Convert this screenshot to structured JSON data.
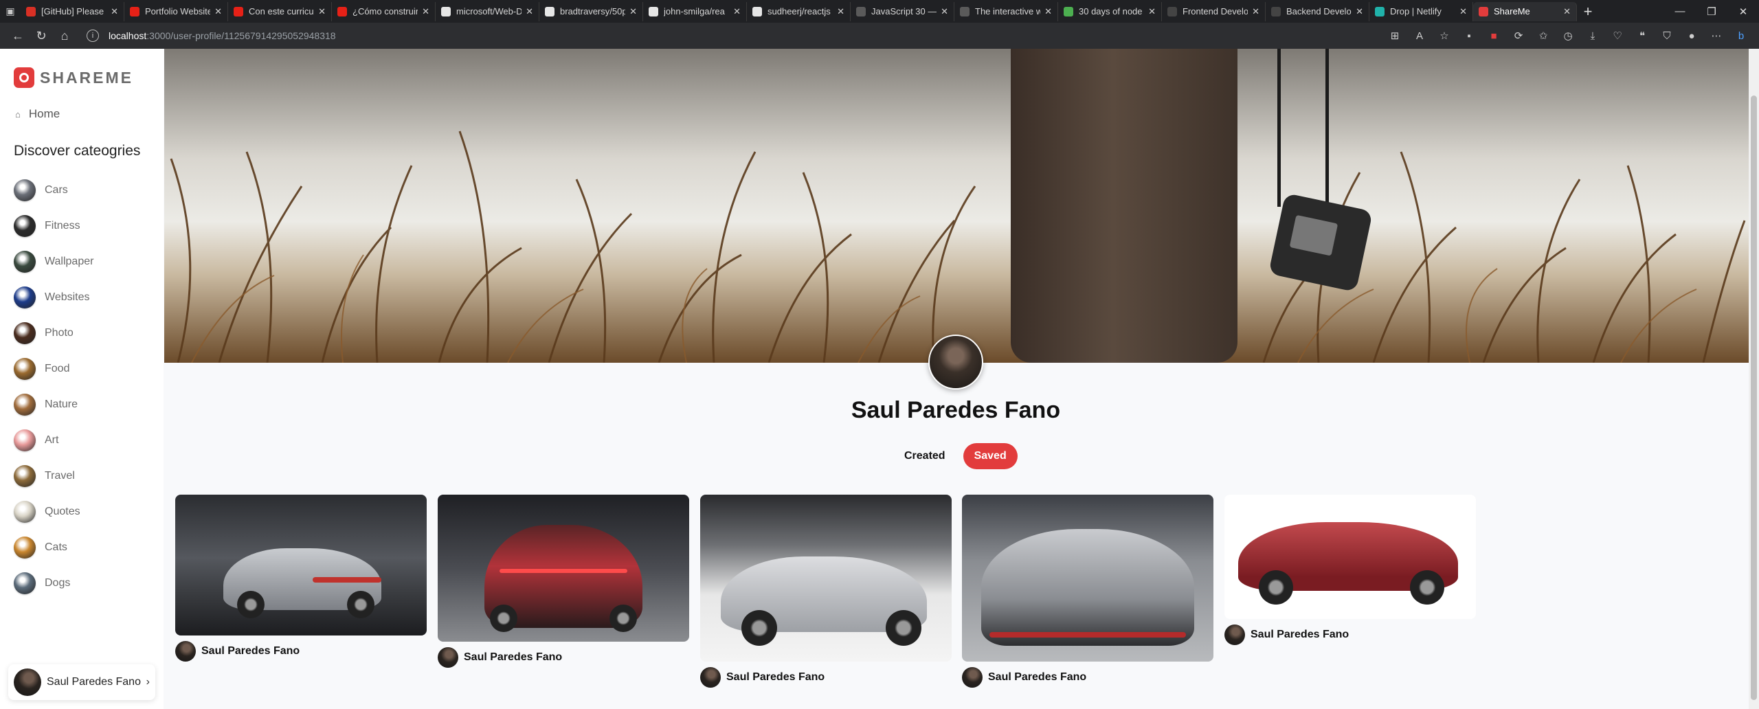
{
  "browser": {
    "tabs": [
      {
        "title": "[GitHub] Please",
        "icon": "gmail-icon",
        "color": "#d93025"
      },
      {
        "title": "Portfolio Website",
        "icon": "youtube-icon",
        "color": "#e62117"
      },
      {
        "title": "Con este curriculu",
        "icon": "youtube-icon",
        "color": "#e62117"
      },
      {
        "title": "¿Cómo construir",
        "icon": "youtube-icon",
        "color": "#e62117"
      },
      {
        "title": "microsoft/Web-D",
        "icon": "github-icon",
        "color": "#e6e6e6"
      },
      {
        "title": "bradtraversy/50p",
        "icon": "github-icon",
        "color": "#e6e6e6"
      },
      {
        "title": "john-smilga/rea",
        "icon": "github-icon",
        "color": "#e6e6e6"
      },
      {
        "title": "sudheerj/reactjs",
        "icon": "github-icon",
        "color": "#e6e6e6"
      },
      {
        "title": "JavaScript 30 —",
        "icon": "js30-icon",
        "color": "#5a5a5a"
      },
      {
        "title": "The interactive w",
        "icon": "ui-icon",
        "color": "#5a5a5a"
      },
      {
        "title": "30 days of node",
        "icon": "node-icon",
        "color": "#4caf50"
      },
      {
        "title": "Frontend Develo",
        "icon": "roadmap-icon",
        "color": "#444"
      },
      {
        "title": "Backend Develop",
        "icon": "roadmap-icon",
        "color": "#444"
      },
      {
        "title": "Drop | Netlify",
        "icon": "netlify-icon",
        "color": "#20b2aa"
      },
      {
        "title": "ShareMe",
        "icon": "shareme-icon",
        "color": "#e23c3c",
        "active": true
      }
    ],
    "url_host": "localhost",
    "url_path": ":3000/user-profile/112567914295052948318"
  },
  "sidebar": {
    "logo_text": "SHAREME",
    "home_label": "Home",
    "categories_heading": "Discover cateogries",
    "categories": [
      {
        "label": "Cars",
        "color": "#6b6f78"
      },
      {
        "label": "Fitness",
        "color": "#2c2c2c"
      },
      {
        "label": "Wallpaper",
        "color": "#3a4a3f"
      },
      {
        "label": "Websites",
        "color": "#1d3c8a"
      },
      {
        "label": "Photo",
        "color": "#4a2c1e"
      },
      {
        "label": "Food",
        "color": "#9a6a2f"
      },
      {
        "label": "Nature",
        "color": "#a06c3c"
      },
      {
        "label": "Art",
        "color": "#e89a9a"
      },
      {
        "label": "Travel",
        "color": "#8c6a3a"
      },
      {
        "label": "Quotes",
        "color": "#d9d4c7"
      },
      {
        "label": "Cats",
        "color": "#c9862e"
      },
      {
        "label": "Dogs",
        "color": "#5b6b7a"
      }
    ],
    "user_name": "Saul Paredes Fano"
  },
  "profile": {
    "name": "Saul Paredes Fano",
    "tab_created": "Created",
    "tab_saved": "Saved"
  },
  "pins": [
    {
      "author": "Saul Paredes Fano",
      "desc": "silver-porsche-911"
    },
    {
      "author": "Saul Paredes Fano",
      "desc": "red-ferrari-rear"
    },
    {
      "author": "Saul Paredes Fano",
      "desc": "silver-porsche-918"
    },
    {
      "author": "Saul Paredes Fano",
      "desc": "silver-lamborghini-veneno"
    },
    {
      "author": "Saul Paredes Fano",
      "desc": "red-ferrari-roma"
    }
  ]
}
